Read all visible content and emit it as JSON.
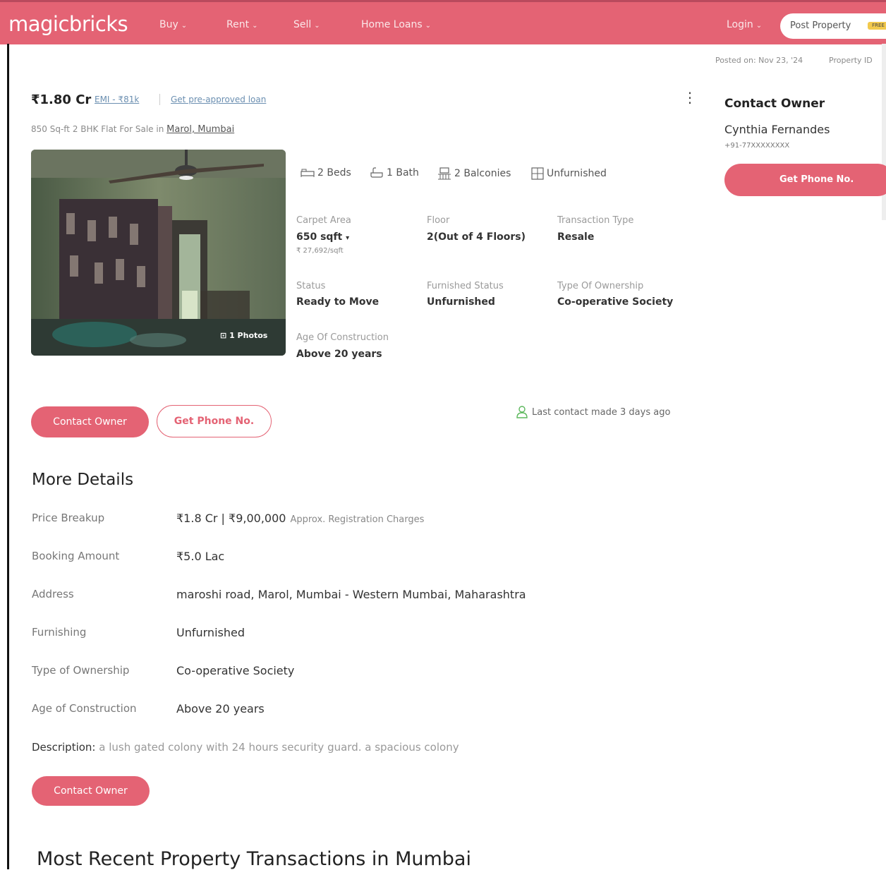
{
  "brand": {
    "logo": "magicbricks",
    "accent": "#e46374"
  },
  "nav": {
    "items": [
      "Buy",
      "Rent",
      "Sell",
      "Home Loans"
    ],
    "login": "Login",
    "post_property": "Post Property",
    "free_badge": "FREE"
  },
  "meta": {
    "posted_on": "Posted on: Nov 23, '24",
    "property_id": "Property ID"
  },
  "listing": {
    "price": "₹1.80 Cr",
    "emi": "EMI - ₹81k",
    "preapproved": "Get pre-approved loan",
    "subtitle_prefix": "850 Sq-ft 2 BHK Flat For Sale in",
    "location": "Marol, Mumbai",
    "photos_badge": "1 Photos",
    "features": {
      "beds": "2 Beds",
      "bath": "1 Bath",
      "balconies": "2 Balconies",
      "furnishing": "Unfurnished"
    },
    "attributes": {
      "carpet_label": "Carpet Area",
      "carpet_value": "650 sqft",
      "carpet_sub": "₹ 27,692/sqft",
      "floor_label": "Floor",
      "floor_value": "2(Out of 4 Floors)",
      "transaction_label": "Transaction Type",
      "transaction_value": "Resale",
      "status_label": "Status",
      "status_value": "Ready to Move",
      "furnished_label": "Furnished Status",
      "furnished_value": "Unfurnished",
      "ownership_label": "Type Of Ownership",
      "ownership_value": "Co-operative Society",
      "age_label": "Age Of Construction",
      "age_value": "Above 20 years"
    },
    "contact_owner_btn": "Contact Owner",
    "get_phone_btn": "Get Phone No.",
    "last_contact": "Last contact made 3 days ago"
  },
  "more_details": {
    "heading": "More Details",
    "rows": [
      {
        "label": "Price Breakup",
        "value": "₹1.8 Cr | ₹9,00,000",
        "extra": "Approx. Registration Charges"
      },
      {
        "label": "Booking Amount",
        "value": "₹5.0 Lac",
        "extra": ""
      },
      {
        "label": "Address",
        "value": "maroshi road, Marol, Mumbai - Western Mumbai, Maharashtra",
        "extra": ""
      },
      {
        "label": "Furnishing",
        "value": "Unfurnished",
        "extra": ""
      },
      {
        "label": "Type of Ownership",
        "value": "Co-operative Society",
        "extra": ""
      },
      {
        "label": "Age of Construction",
        "value": "Above 20 years",
        "extra": ""
      }
    ],
    "description_label": "Description:",
    "description_text": "a lush gated colony with 24 hours security guard. a spacious colony",
    "contact_owner_btn": "Contact Owner"
  },
  "recent_heading": "Most Recent Property Transactions in Mumbai",
  "sidebar": {
    "title": "Contact Owner",
    "name": "Cynthia Fernandes",
    "phone": "+91-77XXXXXXXX",
    "get_phone_btn": "Get Phone No."
  }
}
